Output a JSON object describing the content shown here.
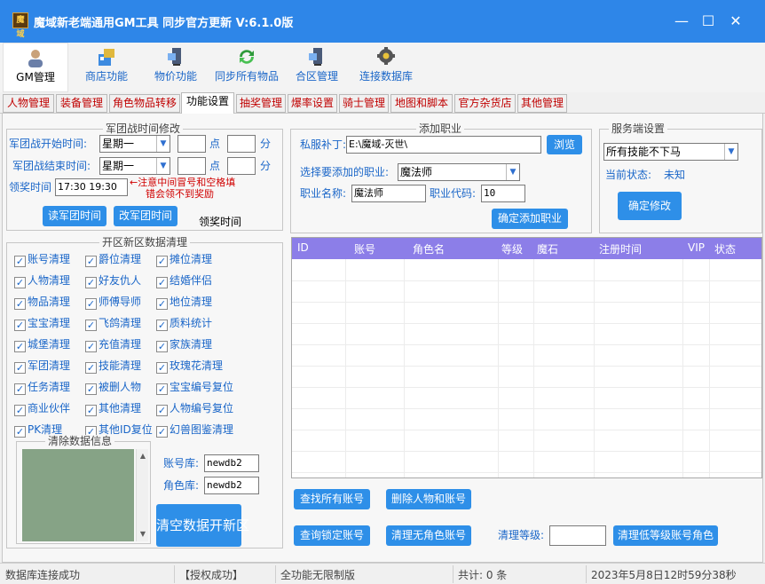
{
  "window": {
    "title": "魔域新老端通用GM工具 同步官方更新 V:6.1.0版",
    "app_icon_text": "魔域",
    "minimize": "—",
    "maximize": "☐",
    "close": "✕"
  },
  "toolbar": {
    "items": [
      {
        "label": "GM管理"
      },
      {
        "label": "商店功能"
      },
      {
        "label": "物价功能"
      },
      {
        "label": "同步所有物品"
      },
      {
        "label": "合区管理"
      },
      {
        "label": "连接数据库"
      }
    ]
  },
  "tabs": [
    {
      "label": "人物管理"
    },
    {
      "label": "装备管理"
    },
    {
      "label": "角色物品转移"
    },
    {
      "label": "功能设置"
    },
    {
      "label": "抽奖管理"
    },
    {
      "label": "爆率设置"
    },
    {
      "label": "骑士管理"
    },
    {
      "label": "地图和脚本"
    },
    {
      "label": "官方杂货店"
    },
    {
      "label": "其他管理"
    }
  ],
  "war": {
    "title": "军团战时间修改",
    "start_label": "军团战开始时间:",
    "start_day": "星期一",
    "start_hour": "",
    "start_min": "",
    "end_label": "军团战结束时间:",
    "end_day": "星期一",
    "end_hour": "",
    "end_min": "",
    "point": "点",
    "minute": "分",
    "reward_label": "领奖时间",
    "reward_value": "17:30 19:30",
    "note_line1": "←注意中间冒号和空格填",
    "note_line2": "错会领不到奖励",
    "read_btn": "读军团时间",
    "change_btn": "改军团时间",
    "reward_caption": "领奖时间"
  },
  "cleanup": {
    "title": "开区新区数据清理",
    "items": [
      [
        "账号清理",
        "爵位清理",
        "摊位清理"
      ],
      [
        "人物清理",
        "好友仇人",
        "结婚伴侣"
      ],
      [
        "物品清理",
        "师傅导师",
        "地位清理"
      ],
      [
        "宝宝清理",
        "飞鸽清理",
        "质料统计"
      ],
      [
        "城堡清理",
        "充值清理",
        "家族清理"
      ],
      [
        "军团清理",
        "技能清理",
        "玫瑰花清理"
      ],
      [
        "任务清理",
        "被删人物",
        "宝宝编号复位"
      ],
      [
        "商业伙伴",
        "其他清理",
        "人物编号复位"
      ],
      [
        "PK清理",
        "其他ID复位",
        "幻兽图鉴清理"
      ]
    ],
    "info_title": "清除数据信息",
    "account_db_label": "账号库:",
    "account_db": "newdb2",
    "role_db_label": "角色库:",
    "role_db": "newdb2",
    "clear_btn": "清空数据开新区"
  },
  "job": {
    "title": "添加职业",
    "patch_label": "私服补丁:",
    "patch_path": "E:\\魔域-灭世\\",
    "browse_btn": "浏览",
    "select_label": "选择要添加的职业:",
    "select_value": "魔法师",
    "name_label": "职业名称:",
    "name_value": "魔法师",
    "code_label": "职业代码:",
    "code_value": "10",
    "confirm_btn": "确定添加职业"
  },
  "server": {
    "title": "服务端设置",
    "select_value": "所有技能不下马",
    "status_label": "当前状态:",
    "status_value": "未知",
    "confirm_btn": "确定修改"
  },
  "grid": {
    "columns": [
      "ID",
      "账号",
      "角色名",
      "等级",
      "魔石",
      "注册时间",
      "VIP",
      "状态"
    ]
  },
  "actions": {
    "find_all": "查找所有账号",
    "delete_all": "删除人物和账号",
    "query_locked": "查询锁定账号",
    "clear_no_role": "清理无角色账号",
    "level_label": "清理等级:",
    "level_value": "",
    "clear_low": "清理低等级账号角色"
  },
  "status": {
    "db": "数据库连接成功",
    "auth": "【授权成功】",
    "edition": "全功能无限制版",
    "count": "共计: 0 条",
    "datetime": "2023年5月8日12时59分38秒"
  },
  "colors": {
    "accent": "#2e86e8",
    "tab_text": "#c00000",
    "grid_header": "#8c7ee8",
    "label_blue": "#1a66c8",
    "note_red": "#d00000"
  }
}
